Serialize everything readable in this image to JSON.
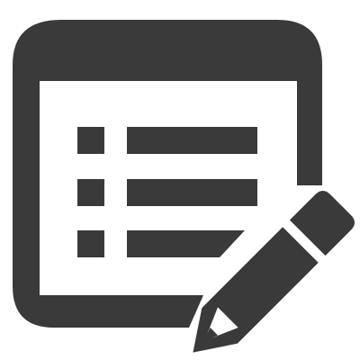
{
  "icon": {
    "name": "edit-list-icon",
    "color": "#3a3a3a",
    "background": "#ffffff"
  },
  "list": {
    "rows": 3
  }
}
